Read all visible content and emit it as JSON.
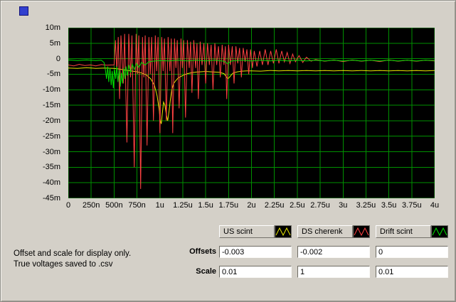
{
  "note": {
    "line1": "Offset and scale for display only.",
    "line2": "True voltages saved to .csv"
  },
  "controls": {
    "offsets_label": "Offsets",
    "scale_label": "Scale",
    "offsets": [
      "-0.003",
      "-0.002",
      "0"
    ],
    "scale": [
      "0.01",
      "1",
      "0.01"
    ]
  },
  "legend": [
    {
      "label": "US scint",
      "color": "#e6e600"
    },
    {
      "label": "DS cherenk",
      "color": "#ff4242"
    },
    {
      "label": "Drift scint",
      "color": "#00e000"
    }
  ],
  "chart_data": {
    "type": "line",
    "title": "",
    "xlabel": "",
    "ylabel": "",
    "xlim": [
      0,
      4000
    ],
    "ylim": [
      -45,
      10
    ],
    "grid": true,
    "grid_color": "#009000",
    "plot_bg": "#000000",
    "x_ticks": [
      {
        "v": 0,
        "label": "0"
      },
      {
        "v": 250,
        "label": "250n"
      },
      {
        "v": 500,
        "label": "500n"
      },
      {
        "v": 750,
        "label": "750n"
      },
      {
        "v": 1000,
        "label": "1u"
      },
      {
        "v": 1250,
        "label": "1.25u"
      },
      {
        "v": 1500,
        "label": "1.5u"
      },
      {
        "v": 1750,
        "label": "1.75u"
      },
      {
        "v": 2000,
        "label": "2u"
      },
      {
        "v": 2250,
        "label": "2.25u"
      },
      {
        "v": 2500,
        "label": "2.5u"
      },
      {
        "v": 2750,
        "label": "2.75u"
      },
      {
        "v": 3000,
        "label": "3u"
      },
      {
        "v": 3250,
        "label": "3.25u"
      },
      {
        "v": 3500,
        "label": "3.5u"
      },
      {
        "v": 3750,
        "label": "3.75u"
      },
      {
        "v": 4000,
        "label": "4u"
      }
    ],
    "y_ticks": [
      {
        "v": 10,
        "label": "10m"
      },
      {
        "v": 5,
        "label": "5m"
      },
      {
        "v": 0,
        "label": "0"
      },
      {
        "v": -5,
        "label": "-5m"
      },
      {
        "v": -10,
        "label": "-10m"
      },
      {
        "v": -15,
        "label": "-15m"
      },
      {
        "v": -20,
        "label": "-20m"
      },
      {
        "v": -25,
        "label": "-25m"
      },
      {
        "v": -30,
        "label": "-30m"
      },
      {
        "v": -35,
        "label": "-35m"
      },
      {
        "v": -40,
        "label": "-40m"
      },
      {
        "v": -45,
        "label": "-45m"
      }
    ],
    "series": [
      {
        "name": "US scint",
        "color": "#e6e600",
        "points": [
          [
            0,
            -3
          ],
          [
            100,
            -3.1
          ],
          [
            200,
            -2.9
          ],
          [
            300,
            -3.1
          ],
          [
            400,
            -3
          ],
          [
            500,
            -3.1
          ],
          [
            550,
            -3.3
          ],
          [
            600,
            -3.6
          ],
          [
            650,
            -3.8
          ],
          [
            700,
            -4
          ],
          [
            750,
            -4.2
          ],
          [
            800,
            -4.6
          ],
          [
            850,
            -5.2
          ],
          [
            900,
            -6.5
          ],
          [
            940,
            -8.5
          ],
          [
            970,
            -12
          ],
          [
            990,
            -16
          ],
          [
            1005,
            -20
          ],
          [
            1015,
            -21
          ],
          [
            1025,
            -18
          ],
          [
            1040,
            -14
          ],
          [
            1055,
            -15
          ],
          [
            1070,
            -18
          ],
          [
            1085,
            -20
          ],
          [
            1100,
            -17
          ],
          [
            1115,
            -13
          ],
          [
            1130,
            -10
          ],
          [
            1150,
            -8
          ],
          [
            1175,
            -7
          ],
          [
            1200,
            -6.2
          ],
          [
            1250,
            -5.4
          ],
          [
            1300,
            -4.8
          ],
          [
            1350,
            -4.5
          ],
          [
            1400,
            -4.3
          ],
          [
            1450,
            -4.2
          ],
          [
            1500,
            -4.1
          ],
          [
            1550,
            -4.2
          ],
          [
            1600,
            -4.3
          ],
          [
            1650,
            -4.4
          ],
          [
            1700,
            -4.8
          ],
          [
            1720,
            -5.6
          ],
          [
            1740,
            -6.4
          ],
          [
            1760,
            -6
          ],
          [
            1780,
            -5.2
          ],
          [
            1800,
            -4.6
          ],
          [
            1850,
            -4.2
          ],
          [
            1900,
            -4
          ],
          [
            1950,
            -3.9
          ],
          [
            2000,
            -3.9
          ],
          [
            2100,
            -4
          ],
          [
            2200,
            -3.8
          ],
          [
            2300,
            -3.9
          ],
          [
            2400,
            -3.8
          ],
          [
            2500,
            -3.9
          ],
          [
            2600,
            -3.8
          ],
          [
            2700,
            -3.9
          ],
          [
            2800,
            -3.8
          ],
          [
            2900,
            -3.9
          ],
          [
            3000,
            -3.8
          ],
          [
            3100,
            -3.9
          ],
          [
            3200,
            -3.8
          ],
          [
            3300,
            -3.9
          ],
          [
            3400,
            -3.8
          ],
          [
            3500,
            -3.9
          ],
          [
            3600,
            -3.8
          ],
          [
            3700,
            -3.9
          ],
          [
            3800,
            -3.8
          ],
          [
            3900,
            -3.9
          ],
          [
            4000,
            -3.8
          ]
        ]
      },
      {
        "name": "DS cherenk",
        "color": "#ff4242",
        "points": [
          [
            0,
            -2
          ],
          [
            60,
            -2.3
          ],
          [
            120,
            -1.8
          ],
          [
            180,
            -2.2
          ],
          [
            240,
            -2
          ],
          [
            300,
            -2.3
          ],
          [
            360,
            -1.9
          ],
          [
            420,
            -2.1
          ],
          [
            470,
            -2
          ],
          [
            500,
            -2
          ],
          [
            515,
            6
          ],
          [
            530,
            -4
          ],
          [
            545,
            7
          ],
          [
            560,
            -13
          ],
          [
            575,
            7.5
          ],
          [
            600,
            -8
          ],
          [
            615,
            8
          ],
          [
            640,
            -27
          ],
          [
            660,
            8
          ],
          [
            680,
            -6
          ],
          [
            695,
            7.5
          ],
          [
            720,
            -35
          ],
          [
            740,
            8
          ],
          [
            755,
            -5
          ],
          [
            770,
            7.5
          ],
          [
            790,
            -42
          ],
          [
            810,
            7
          ],
          [
            825,
            -6
          ],
          [
            840,
            7.5
          ],
          [
            860,
            -28
          ],
          [
            880,
            7
          ],
          [
            895,
            -5
          ],
          [
            910,
            7
          ],
          [
            930,
            -20
          ],
          [
            950,
            7.5
          ],
          [
            965,
            -4
          ],
          [
            980,
            7
          ],
          [
            1000,
            -24
          ],
          [
            1020,
            7
          ],
          [
            1035,
            -4
          ],
          [
            1050,
            6.5
          ],
          [
            1070,
            -20
          ],
          [
            1090,
            7
          ],
          [
            1110,
            -4
          ],
          [
            1125,
            6.5
          ],
          [
            1140,
            -24
          ],
          [
            1160,
            6.5
          ],
          [
            1175,
            -3
          ],
          [
            1190,
            6
          ],
          [
            1210,
            -16
          ],
          [
            1230,
            6.5
          ],
          [
            1245,
            -3
          ],
          [
            1260,
            6
          ],
          [
            1280,
            -19
          ],
          [
            1300,
            6
          ],
          [
            1320,
            -3
          ],
          [
            1335,
            5.5
          ],
          [
            1350,
            -11
          ],
          [
            1370,
            6
          ],
          [
            1390,
            -3
          ],
          [
            1405,
            5
          ],
          [
            1420,
            -13
          ],
          [
            1440,
            5.5
          ],
          [
            1460,
            -2
          ],
          [
            1480,
            5
          ],
          [
            1500,
            -8
          ],
          [
            1520,
            5
          ],
          [
            1540,
            -2
          ],
          [
            1560,
            4.5
          ],
          [
            1580,
            -10
          ],
          [
            1600,
            5
          ],
          [
            1620,
            -2
          ],
          [
            1640,
            4
          ],
          [
            1660,
            -6
          ],
          [
            1680,
            4.5
          ],
          [
            1700,
            -2
          ],
          [
            1715,
            4
          ],
          [
            1730,
            -13
          ],
          [
            1750,
            4.5
          ],
          [
            1770,
            -2
          ],
          [
            1790,
            4
          ],
          [
            1810,
            -8
          ],
          [
            1830,
            4
          ],
          [
            1850,
            -1.5
          ],
          [
            1870,
            3.5
          ],
          [
            1890,
            -6
          ],
          [
            1910,
            3.5
          ],
          [
            1930,
            -1
          ],
          [
            1950,
            3
          ],
          [
            1970,
            -5
          ],
          [
            1990,
            3
          ],
          [
            2010,
            -3
          ],
          [
            2030,
            2.5
          ],
          [
            2060,
            -2.5
          ],
          [
            2090,
            2.5
          ],
          [
            2120,
            -2
          ],
          [
            2150,
            3
          ],
          [
            2180,
            -2
          ],
          [
            2210,
            2.5
          ],
          [
            2240,
            -1.5
          ],
          [
            2270,
            3
          ],
          [
            2300,
            -1.5
          ],
          [
            2330,
            2.5
          ],
          [
            2360,
            -1
          ],
          [
            2390,
            2
          ],
          [
            2420,
            -1.5
          ],
          [
            2450,
            1.5
          ],
          [
            2480,
            -1
          ],
          [
            2520,
            1
          ],
          [
            2560,
            -1.2
          ],
          [
            2600,
            0.5
          ],
          [
            2650,
            -0.8
          ],
          [
            2700,
            -0.3
          ],
          [
            2800,
            -0.8
          ],
          [
            2900,
            -0.4
          ],
          [
            3000,
            -0.9
          ],
          [
            3100,
            -0.4
          ],
          [
            3200,
            -0.8
          ],
          [
            3300,
            -0.5
          ],
          [
            3400,
            -0.9
          ],
          [
            3500,
            -0.4
          ],
          [
            3600,
            -0.8
          ],
          [
            3700,
            -0.5
          ],
          [
            3800,
            -0.8
          ],
          [
            3900,
            -0.5
          ],
          [
            4000,
            -0.7
          ]
        ]
      },
      {
        "name": "Drift scint",
        "color": "#00e000",
        "points": [
          [
            0,
            -0.4
          ],
          [
            100,
            -0.6
          ],
          [
            200,
            -0.4
          ],
          [
            300,
            -0.6
          ],
          [
            360,
            -0.5
          ],
          [
            390,
            -1.2
          ],
          [
            405,
            -3.5
          ],
          [
            418,
            -6.5
          ],
          [
            430,
            -2.5
          ],
          [
            442,
            -7.5
          ],
          [
            455,
            -3
          ],
          [
            468,
            -8.5
          ],
          [
            480,
            -4
          ],
          [
            492,
            -9.5
          ],
          [
            505,
            -3.5
          ],
          [
            518,
            -6.5
          ],
          [
            530,
            -2.5
          ],
          [
            542,
            -7.5
          ],
          [
            555,
            -3.5
          ],
          [
            568,
            -9
          ],
          [
            580,
            -4.5
          ],
          [
            592,
            -8
          ],
          [
            605,
            -3
          ],
          [
            618,
            -6.5
          ],
          [
            630,
            -2.5
          ],
          [
            645,
            -5.5
          ],
          [
            660,
            -2
          ],
          [
            680,
            -4.5
          ],
          [
            700,
            -1.8
          ],
          [
            720,
            -3.5
          ],
          [
            745,
            -1.5
          ],
          [
            770,
            -2.8
          ],
          [
            800,
            -1.2
          ],
          [
            840,
            -2
          ],
          [
            880,
            -1
          ],
          [
            920,
            -0.8
          ],
          [
            1000,
            -0.6
          ],
          [
            1100,
            -0.7
          ],
          [
            1200,
            -0.5
          ],
          [
            1300,
            -0.7
          ],
          [
            1400,
            -0.5
          ],
          [
            1500,
            -0.7
          ],
          [
            1600,
            -0.5
          ],
          [
            1700,
            -0.8
          ],
          [
            1740,
            -1.6
          ],
          [
            1780,
            -0.7
          ],
          [
            1900,
            -0.5
          ],
          [
            2000,
            -0.7
          ],
          [
            2100,
            -0.5
          ],
          [
            2200,
            -0.7
          ],
          [
            2300,
            -0.5
          ],
          [
            2400,
            -0.7
          ],
          [
            2500,
            -0.5
          ],
          [
            2600,
            -0.7
          ],
          [
            2700,
            -0.5
          ],
          [
            2800,
            -0.7
          ],
          [
            2900,
            -0.5
          ],
          [
            3000,
            -0.7
          ],
          [
            3100,
            -0.5
          ],
          [
            3200,
            -0.7
          ],
          [
            3300,
            -0.5
          ],
          [
            3400,
            -0.7
          ],
          [
            3500,
            -0.5
          ],
          [
            3600,
            -0.7
          ],
          [
            3700,
            -0.5
          ],
          [
            3800,
            -0.7
          ],
          [
            3900,
            -0.5
          ],
          [
            4000,
            -0.6
          ]
        ]
      }
    ]
  }
}
